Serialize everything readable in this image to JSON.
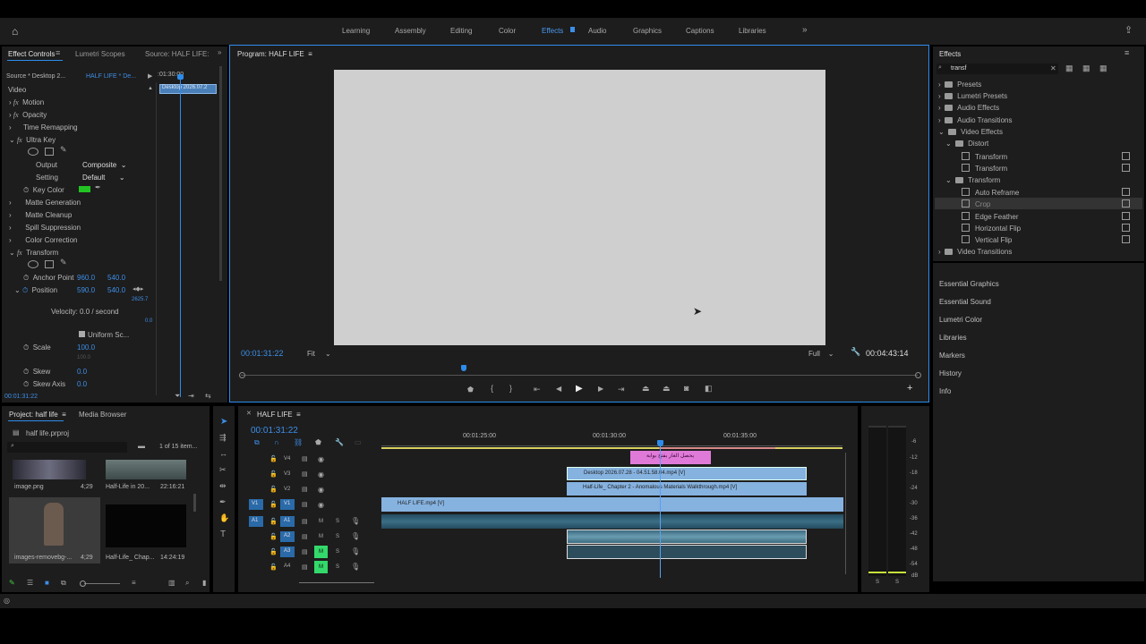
{
  "workspaces": {
    "items": [
      "Learning",
      "Assembly",
      "Editing",
      "Color",
      "Effects",
      "Audio",
      "Graphics",
      "Captions",
      "Libraries"
    ],
    "active": "Effects"
  },
  "effect_controls": {
    "tabs": [
      "Effect Controls",
      "Lumetri Scopes",
      "Source: HALF LIFE:"
    ],
    "source": "Source * Desktop 2...",
    "sequence": "HALF LIFE * De...",
    "timecode_top": ":01:30:00",
    "clip_label": "Desktop 2026.07.2",
    "section": "Video",
    "motion": "Motion",
    "opacity": "Opacity",
    "time_remap": "Time Remapping",
    "ultra_key": "Ultra Key",
    "output_label": "Output",
    "output_value": "Composite",
    "setting_label": "Setting",
    "setting_value": "Default",
    "key_color_label": "Key Color",
    "key_color": "#22c422",
    "matte_generation": "Matte Generation",
    "matte_cleanup": "Matte Cleanup",
    "spill": "Spill Suppression",
    "color_correction": "Color Correction",
    "transform": "Transform",
    "anchor_label": "Anchor Point",
    "anchor_x": "960.0",
    "anchor_y": "540.0",
    "position_label": "Position",
    "position_x": "590.0",
    "position_y": "540.0",
    "graph_val": "2625.7",
    "graph_zero": "0.0",
    "velocity": "Velocity: 0.0 / second",
    "uniform": "Uniform Sc...",
    "scale_label": "Scale",
    "scale": "100.0",
    "scale2": "100.0",
    "skew_label": "Skew",
    "skew": "0.0",
    "skew_axis_label": "Skew Axis",
    "skew_axis": "0.0",
    "bottom_tc": "00:01:31:22"
  },
  "program": {
    "title": "Program: HALF LIFE",
    "timecode": "00:01:31:22",
    "fit": "Fit",
    "quality": "Full",
    "duration": "00:04:43:14",
    "playhead": 0.33
  },
  "effects": {
    "title": "Effects",
    "search": "transf",
    "tree": [
      "Presets",
      "Lumetri Presets",
      "Audio Effects",
      "Audio Transitions",
      "Video Effects",
      "Distort",
      "Transform",
      "Transform",
      "Transform",
      "Auto Reframe",
      "Crop",
      "Edge Feather",
      "Horizontal Flip",
      "Vertical Flip",
      "Video Transitions"
    ],
    "menu": [
      "Essential Graphics",
      "Essential Sound",
      "Lumetri Color",
      "Libraries",
      "Markers",
      "History",
      "Info"
    ]
  },
  "project": {
    "tabs": [
      "Project: half life",
      "Media Browser"
    ],
    "file": "half life.prproj",
    "count": "1 of 15 item...",
    "items": [
      {
        "name": "image.png",
        "dur": "4;29"
      },
      {
        "name": "Half-Life in 20...",
        "dur": "22:16:21"
      },
      {
        "name": "images-removebg-...",
        "dur": "4;29"
      },
      {
        "name": "Half-Life_ Chap...",
        "dur": "14:24:19"
      }
    ]
  },
  "timeline": {
    "title": "HALF LIFE",
    "timecode": "00:01:31:22",
    "ruler": [
      "00:01:25:00",
      "00:01:30:00",
      "00:01:35:00"
    ],
    "video_tracks": [
      "V4",
      "V3",
      "V2",
      "V1"
    ],
    "audio_tracks": [
      "A1",
      "A2",
      "A3",
      "A4"
    ],
    "src_v": "V1",
    "src_a": "A1",
    "clips": {
      "v4": "يحصل الغاز بفتح بوابة",
      "v3": "Desktop 2026.07.28 - 04.51.58.04.mp4 [V]",
      "v2": "Half-Life_ Chapter 2 - Anomalous Materials Walkthrough.mp4 [V]",
      "v1": "HALF LIFE.mp4 [V]"
    },
    "m": "M",
    "s": "S"
  },
  "meter": {
    "ticks": [
      "-6",
      "-12",
      "-18",
      "-24",
      "-30",
      "-36",
      "-42",
      "-48",
      "-54",
      "dB"
    ],
    "s": "S"
  }
}
